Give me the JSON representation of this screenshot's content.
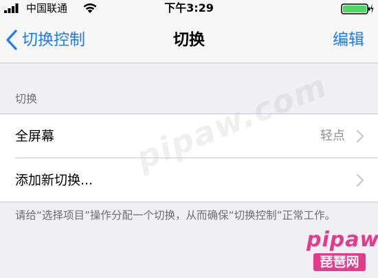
{
  "status_bar": {
    "carrier": "中国联通",
    "time": "下午3:29"
  },
  "nav": {
    "back_label": "切换控制",
    "title": "切换",
    "edit_label": "编辑"
  },
  "section": {
    "header": "切换",
    "rows": [
      {
        "label": "全屏幕",
        "detail": "轻点"
      },
      {
        "label": "添加新切换..."
      }
    ],
    "footer": "请给“选择项目”操作分配一个切换，从而确保“切换控制”正常工作。"
  },
  "watermark": {
    "center": "pipaw.com",
    "corner_top": "pipaw",
    "corner_bottom": "琵琶网"
  },
  "colors": {
    "accent": "#1a7cf5",
    "battery": "#4cd964",
    "watermark": "#e33a8b"
  }
}
